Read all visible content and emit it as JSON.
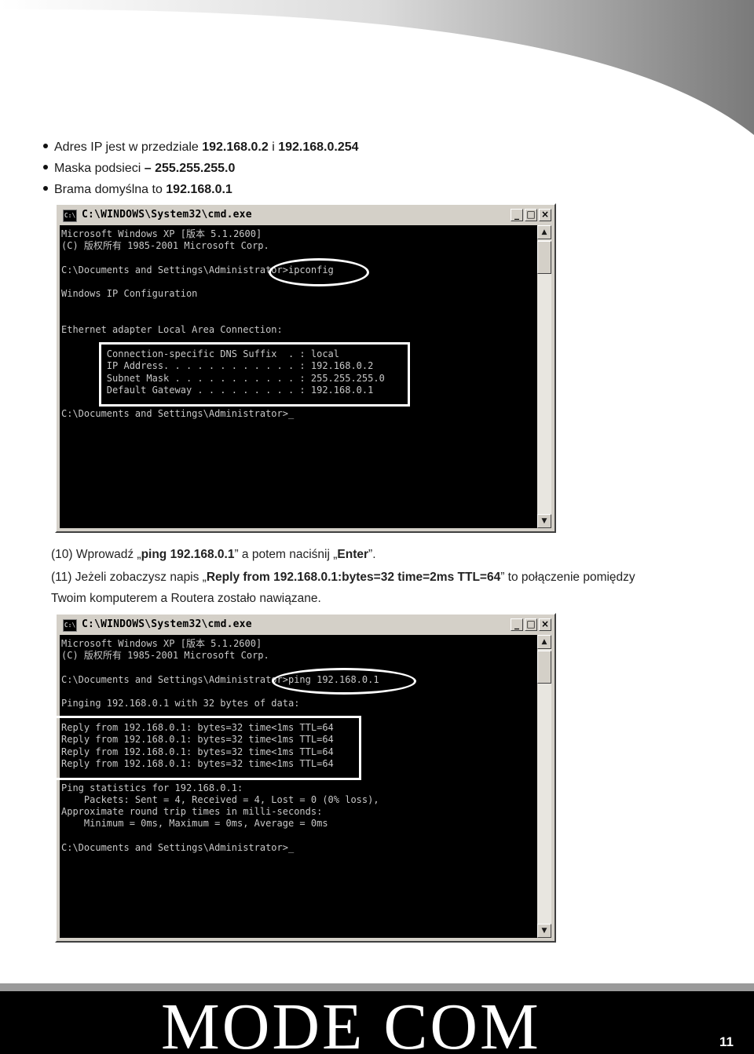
{
  "bullets": [
    {
      "text": "Adres IP jest w przedziale ",
      "bold": "192.168.0.2",
      "mid": " i ",
      "bold2": "192.168.0.254"
    },
    {
      "text": "Maska podsieci ",
      "bold": "– 255.255.255.0"
    },
    {
      "text": "Brama domyślna to ",
      "bold": "192.168.0.1"
    }
  ],
  "cmd1": {
    "title": "C:\\WINDOWS\\System32\\cmd.exe",
    "icon_label": "C:\\",
    "lines": "Microsoft Windows XP [版本 5.1.2600]\n(C) 版权所有 1985-2001 Microsoft Corp.\n\nC:\\Documents and Settings\\Administrator>ipconfig\n\nWindows IP Configuration\n\n\nEthernet adapter Local Area Connection:\n\n        Connection-specific DNS Suffix  . : local\n        IP Address. . . . . . . . . . . . : 192.168.0.2\n        Subnet Mask . . . . . . . . . . . : 255.255.255.0\n        Default Gateway . . . . . . . . . : 192.168.0.1\n\nC:\\Documents and Settings\\Administrator>_"
  },
  "step10": {
    "prefix": "(10) Wprowadź „",
    "cmd": "ping 192.168.0.1",
    "mid": "” a potem naciśnij „",
    "key": "Enter",
    "suffix": "”."
  },
  "step11": {
    "prefix": "(11) Jeżeli zobaczysz napis „",
    "reply": "Reply from 192.168.0.1:bytes=32 time=2ms TTL=64",
    "suffix": "” to połączenie pomiędzy",
    "line2": "Twoim komputerem a  Routera zostało nawiązane."
  },
  "cmd2": {
    "title": "C:\\WINDOWS\\System32\\cmd.exe",
    "icon_label": "C:\\",
    "lines": "Microsoft Windows XP [版本 5.1.2600]\n(C) 版权所有 1985-2001 Microsoft Corp.\n\nC:\\Documents and Settings\\Administrator>ping 192.168.0.1\n\nPinging 192.168.0.1 with 32 bytes of data:\n\nReply from 192.168.0.1: bytes=32 time<1ms TTL=64\nReply from 192.168.0.1: bytes=32 time<1ms TTL=64\nReply from 192.168.0.1: bytes=32 time<1ms TTL=64\nReply from 192.168.0.1: bytes=32 time<1ms TTL=64\n\nPing statistics for 192.168.0.1:\n    Packets: Sent = 4, Received = 4, Lost = 0 (0% loss),\nApproximate round trip times in milli-seconds:\n    Minimum = 0ms, Maximum = 0ms, Average = 0ms\n\nC:\\Documents and Settings\\Administrator>_"
  },
  "footer": {
    "brand": "MODE COM",
    "page": "11"
  }
}
